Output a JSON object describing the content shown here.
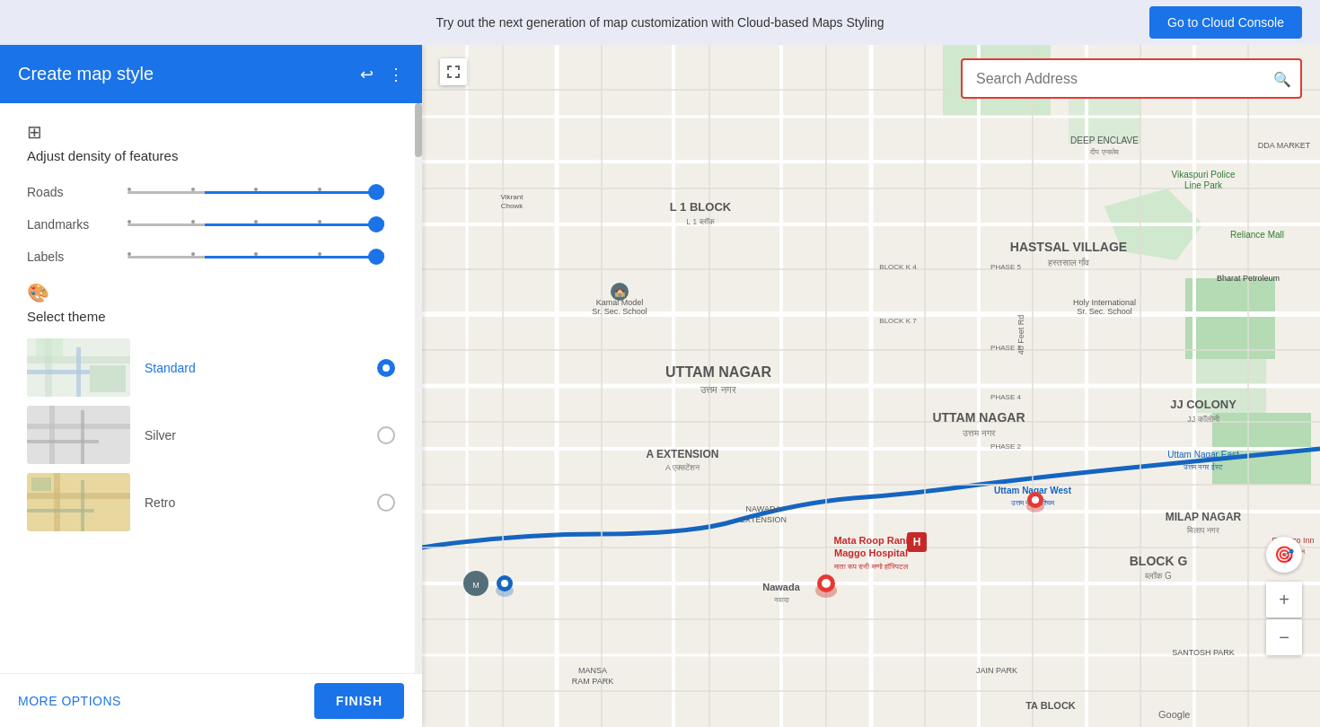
{
  "banner": {
    "text": "Try out the next generation of map customization with Cloud-based Maps Styling",
    "button_label": "Go to Cloud Console"
  },
  "sidebar": {
    "title": "Create map style",
    "density_section": {
      "title": "Adjust density of features",
      "sliders": [
        {
          "label": "Roads",
          "value": 100
        },
        {
          "label": "Landmarks",
          "value": 100
        },
        {
          "label": "Labels",
          "value": 100
        }
      ]
    },
    "theme_section": {
      "title": "Select theme",
      "themes": [
        {
          "name": "Standard",
          "selected": true
        },
        {
          "name": "Silver",
          "selected": false
        },
        {
          "name": "Retro",
          "selected": false
        }
      ]
    },
    "footer": {
      "more_options": "MORE OPTIONS",
      "finish": "FINISH"
    }
  },
  "map": {
    "search_placeholder": "Search Address"
  }
}
